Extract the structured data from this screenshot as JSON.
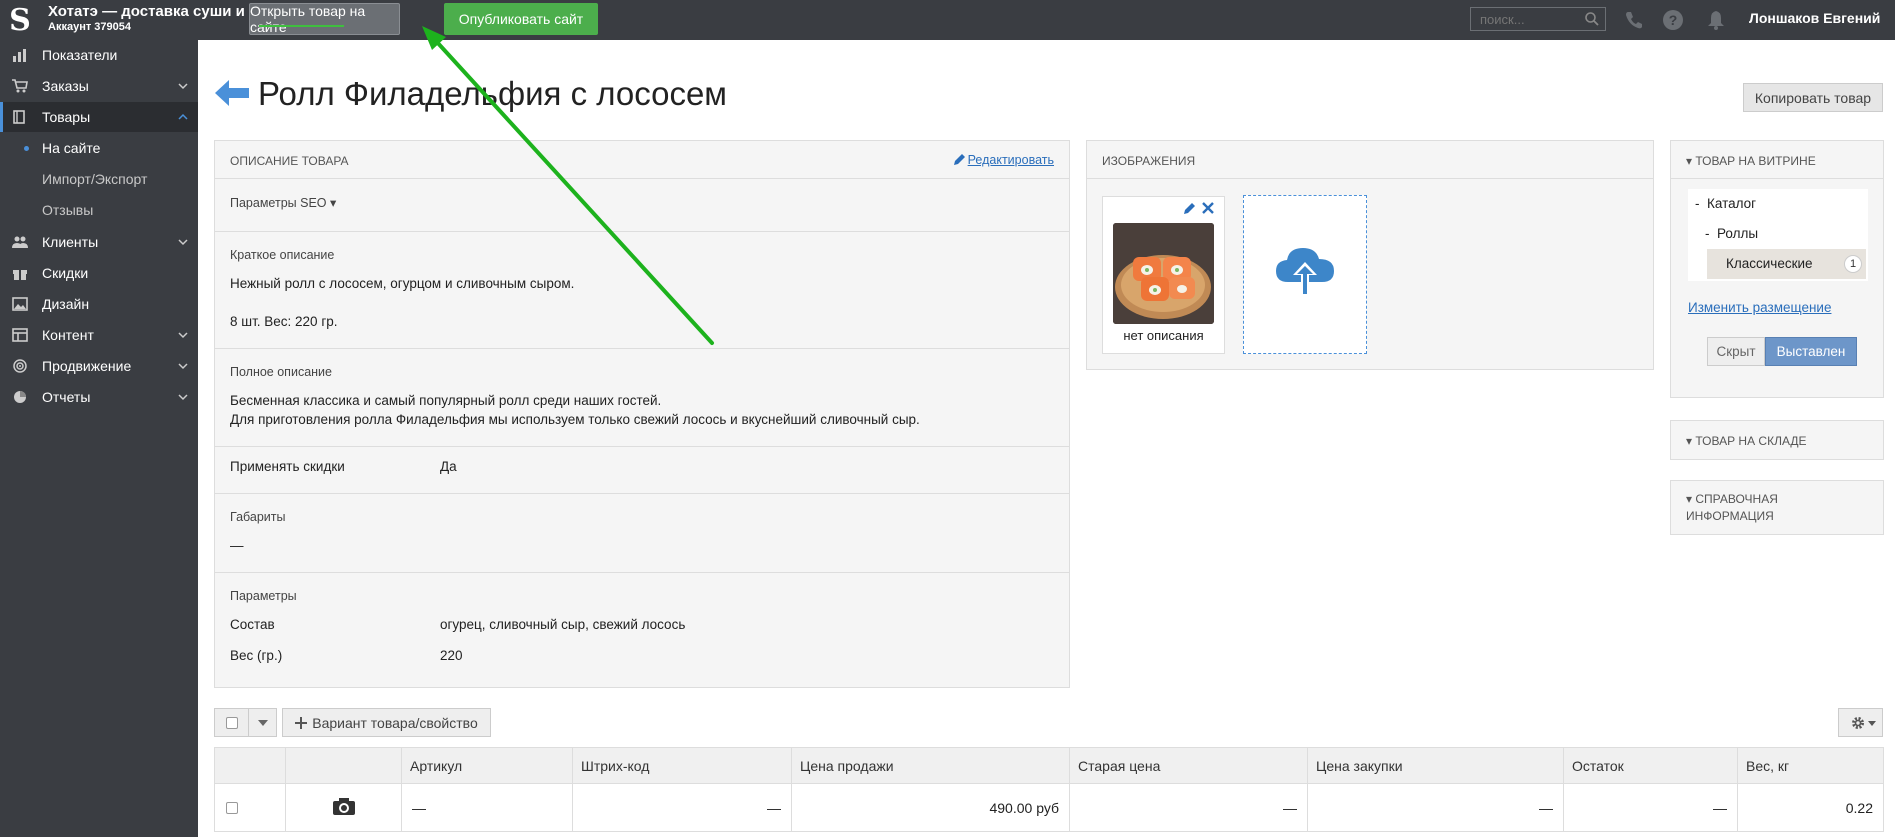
{
  "topbar": {
    "shop_title": "Хотатэ — доставка суши и роллов",
    "account": "Аккаунт 379054",
    "open_on_site": "Открыть товар на сайте",
    "publish_site": "Опубликовать сайт",
    "search_placeholder": "поиск...",
    "user_name": "Лоншаков Евгений"
  },
  "sidebar": {
    "items": [
      {
        "label": "Показатели",
        "icon": "bar-chart-icon"
      },
      {
        "label": "Заказы",
        "icon": "cart-icon"
      },
      {
        "label": "Товары",
        "icon": "book-icon"
      },
      {
        "label": "Клиенты",
        "icon": "users-icon"
      },
      {
        "label": "Скидки",
        "icon": "gift-icon"
      },
      {
        "label": "Дизайн",
        "icon": "image-icon"
      },
      {
        "label": "Контент",
        "icon": "content-icon"
      },
      {
        "label": "Продвижение",
        "icon": "target-icon"
      },
      {
        "label": "Отчеты",
        "icon": "pie-icon"
      }
    ],
    "sub_items": [
      "На сайте",
      "Импорт/Экспорт",
      "Отзывы"
    ]
  },
  "page": {
    "title": "Ролл Филадельфия с лососем",
    "copy_button": "Копировать товар"
  },
  "description": {
    "header": "ОПИСАНИЕ ТОВАРА",
    "edit_link": "Редактировать",
    "seo": "Параметры SEO",
    "short_label": "Краткое описание",
    "short_line1": "Нежный ролл с лососем, огурцом и сливочным сыром.",
    "short_line2": "8 шт. Вес: 220 гр.",
    "full_label": "Полное описание",
    "full_line1": "Бесменная классика и самый популярный ролл среди наших гостей.",
    "full_line2": "Для приготовления ролла Филадельфия мы используем только свежий лосось и вкуснейший сливочный сыр.",
    "discount_label": "Применять скидки",
    "discount_value": "Да",
    "dims_label": "Габариты",
    "dims_value": "—",
    "params_label": "Параметры",
    "composition_label": "Состав",
    "composition_value": "огурец, сливочный сыр, свежий лосось",
    "weight_label": "Вес (гр.)",
    "weight_value": "220"
  },
  "images": {
    "header": "ИЗОБРАЖЕНИЯ",
    "caption": "нет описания"
  },
  "showcase": {
    "header": "▾ ТОВАР НА ВИТРИНЕ",
    "catalog": "Каталог",
    "rolls": "Роллы",
    "classic": "Классические",
    "classic_count": "1",
    "change_link": "Изменить размещение",
    "hidden": "Скрыт",
    "shown": "Выставлен"
  },
  "stock": {
    "header": "▾ ТОВАР НА СКЛАДЕ"
  },
  "reference": {
    "header_line1": "▾ СПРАВОЧНАЯ",
    "header_line2": "ИНФОРМАЦИЯ"
  },
  "variants": {
    "add_button": "Вариант товара/свойство",
    "columns": [
      "Артикул",
      "Штрих-код",
      "Цена продажи",
      "Старая цена",
      "Цена закупки",
      "Остаток",
      "Вес, кг"
    ],
    "row": {
      "sku": "—",
      "barcode": "—",
      "price": "490.00 руб",
      "old_price": "—",
      "cost": "—",
      "stock": "—",
      "weight": "0.22"
    }
  },
  "colors": {
    "topbar": "#3a3d42",
    "publish": "#4cae4c",
    "accent": "#4a90d9",
    "annotation_arrow": "#1db21d"
  }
}
